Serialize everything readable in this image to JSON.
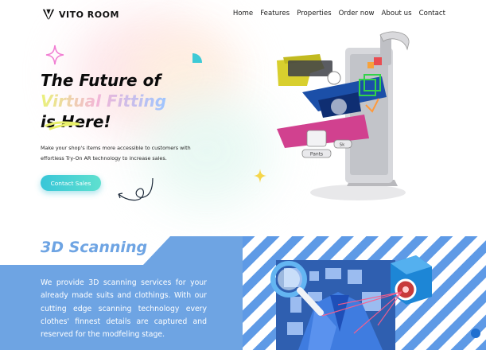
{
  "brand": {
    "name": "VITO ROOM",
    "logo_icon": "vito-room-logo-icon"
  },
  "nav": {
    "items": [
      {
        "label": "Home"
      },
      {
        "label": "Features"
      },
      {
        "label": "Properties"
      },
      {
        "label": "Order now"
      },
      {
        "label": "About us"
      },
      {
        "label": "Contact"
      }
    ]
  },
  "hero": {
    "title_line1": "The Future of",
    "title_line2": "Virtual Fitting",
    "title_line3": "is Here!",
    "description": "Make your shop's items more accessible to customers with effortless Try-On AR technology to increase sales.",
    "cta_label": "Contact Sales",
    "illustration": {
      "panel_label_1": "Pants",
      "panel_label_2": "Sk"
    }
  },
  "scanning": {
    "title": "3D Scanning",
    "body": "We provide 3D scanning services for your already made suits and clothings. With our cutting edge scanning technology every clothes' finnest details are captured and reserved for the modfeling stage."
  },
  "colors": {
    "accent_teal": "#3ecad6",
    "section_blue": "#6ea4e3",
    "stripe_blue": "#5e9ae6",
    "gradient_yellow": "#e9f27a",
    "gradient_pink": "#f3b6d7",
    "gradient_blue": "#9ec5ff"
  },
  "icons": [
    "sparkle-icon",
    "teal-shape-icon",
    "sparkle-yellow-icon",
    "swirl-arrow-icon",
    "magnifier-icon",
    "scanner-camera-icon"
  ]
}
